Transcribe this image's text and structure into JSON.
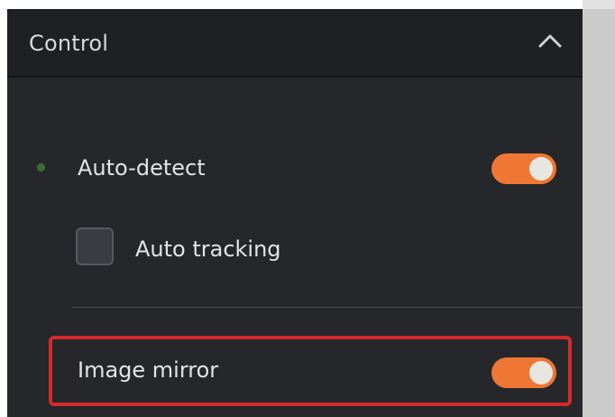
{
  "panel": {
    "header": {
      "title": "Control",
      "collapse_icon": "chevron-up-icon"
    },
    "auto_detect": {
      "label": "Auto-detect",
      "toggle_on": true,
      "status_indicator_color": "#3d6b32"
    },
    "auto_tracking": {
      "label": "Auto tracking",
      "checked": false
    },
    "image_mirror": {
      "label": "Image mirror",
      "toggle_on": true,
      "highlighted": true
    }
  },
  "colors": {
    "panel_background": "#26272b",
    "header_background": "#1f2023",
    "toggle_accent": "#ee7733",
    "highlight_border": "#d62a2a",
    "text": "#e3e3e6"
  }
}
